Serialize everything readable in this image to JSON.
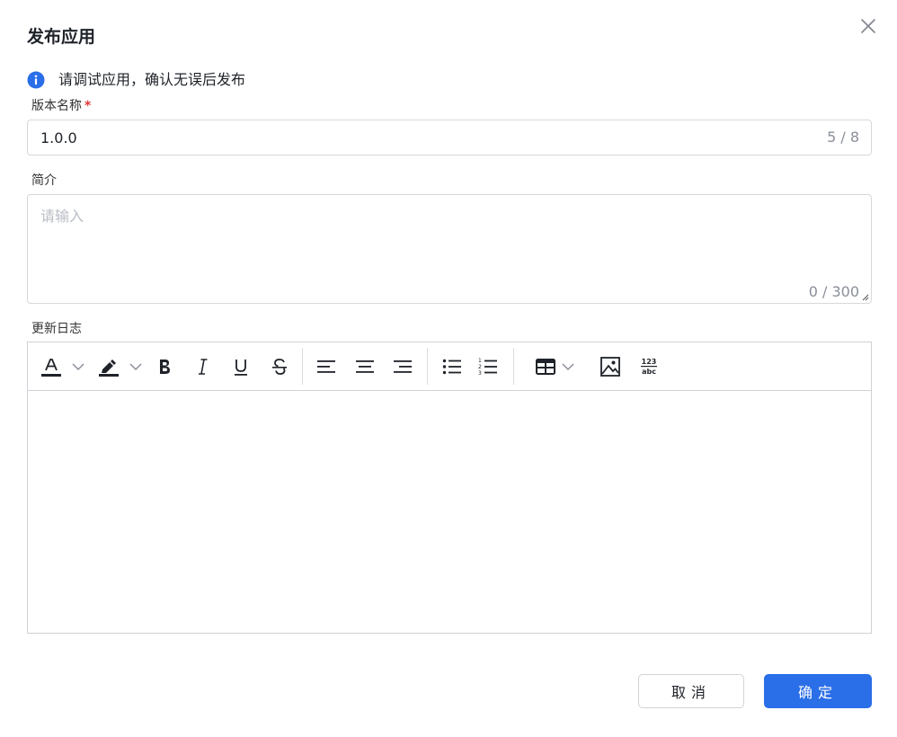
{
  "dialog": {
    "title": "发布应用",
    "info_text": "请调试应用，确认无误后发布"
  },
  "version": {
    "label": "版本名称",
    "required_mark": "*",
    "value": "1.0.0",
    "counter": "5 / 8"
  },
  "intro": {
    "label": "简介",
    "placeholder": "请输入",
    "counter": "0 / 300"
  },
  "changelog": {
    "label": "更新日志",
    "toolbar": {
      "items": [
        "font-color-icon",
        "highlight-icon",
        "bold-icon",
        "italic-icon",
        "underline-icon",
        "strikethrough-icon",
        "align-left-icon",
        "align-center-icon",
        "align-right-icon",
        "bullet-list-icon",
        "numbered-list-icon",
        "table-icon",
        "image-icon",
        "formula-icon"
      ],
      "formula_top": "123",
      "formula_bottom": "abc"
    }
  },
  "buttons": {
    "cancel": "取消",
    "confirm": "确定"
  },
  "colors": {
    "accent": "#2a6ee8",
    "required": "#e03a3a"
  }
}
